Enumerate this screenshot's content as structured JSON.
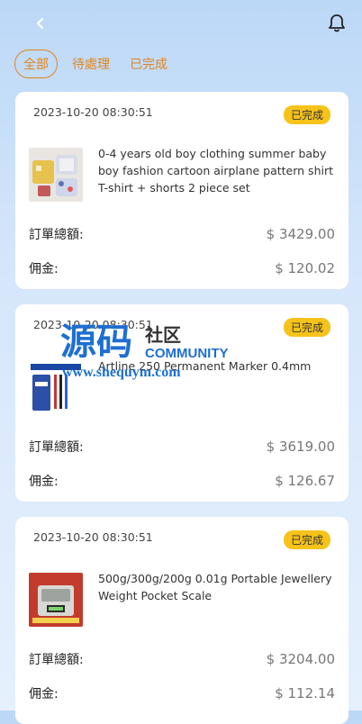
{
  "tabs": [
    {
      "label": "全部",
      "active": true
    },
    {
      "label": "待處理",
      "active": false
    },
    {
      "label": "已完成",
      "active": false
    }
  ],
  "colors": {
    "accent": "#e3841a",
    "badge": "#f6c31b",
    "watermark_blue": "#1e6fd1"
  },
  "orders": [
    {
      "date": "2023-10-20 08:30:51",
      "status": "已完成",
      "product": "0-4 years old boy clothing summer baby boy fashion cartoon airplane pattern shirt T-shirt + shorts 2 piece set",
      "total_label": "訂單總額:",
      "total": "$ 3429.00",
      "commission_label": "佣金:",
      "commission": "$ 120.02"
    },
    {
      "date": "2023-10-20 08:30:51",
      "status": "已完成",
      "product": "Artline 250 Permanent Marker 0.4mm",
      "total_label": "訂單總額:",
      "total": "$ 3619.00",
      "commission_label": "佣金:",
      "commission": "$ 126.67"
    },
    {
      "date": "2023-10-20 08:30:51",
      "status": "已完成",
      "product": "500g/300g/200g 0.01g Portable Jewellery Weight Pocket Scale",
      "total_label": "訂單總額:",
      "total": "$ 3204.00",
      "commission_label": "佣金:",
      "commission": "$ 112.14"
    }
  ],
  "watermark": {
    "big": "源码",
    "small": "社区",
    "latin": "COMMUNITY",
    "url": "www.shequym.com"
  },
  "icons": [
    "back-arrow-icon",
    "bell-icon"
  ]
}
